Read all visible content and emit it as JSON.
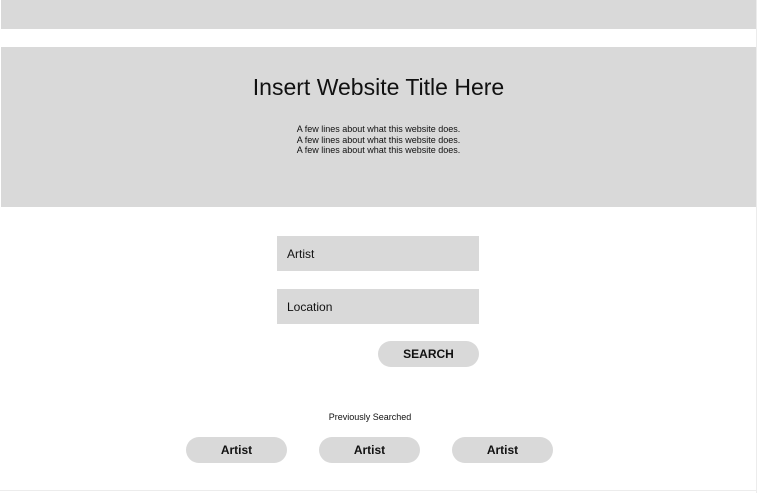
{
  "hero": {
    "title": "Insert Website Title Here",
    "description_lines": [
      "A few lines about what this website does.",
      "A few lines about what this website does.",
      "A few lines about what this website does."
    ]
  },
  "search": {
    "artist_placeholder": "Artist",
    "location_placeholder": "Location",
    "button_label": "SEARCH"
  },
  "previous": {
    "label": "Previously Searched",
    "items": [
      {
        "label": "Artist"
      },
      {
        "label": "Artist"
      },
      {
        "label": "Artist"
      }
    ]
  },
  "colors": {
    "panel": "#d9d9d9",
    "background": "#ffffff",
    "text": "#111111"
  }
}
